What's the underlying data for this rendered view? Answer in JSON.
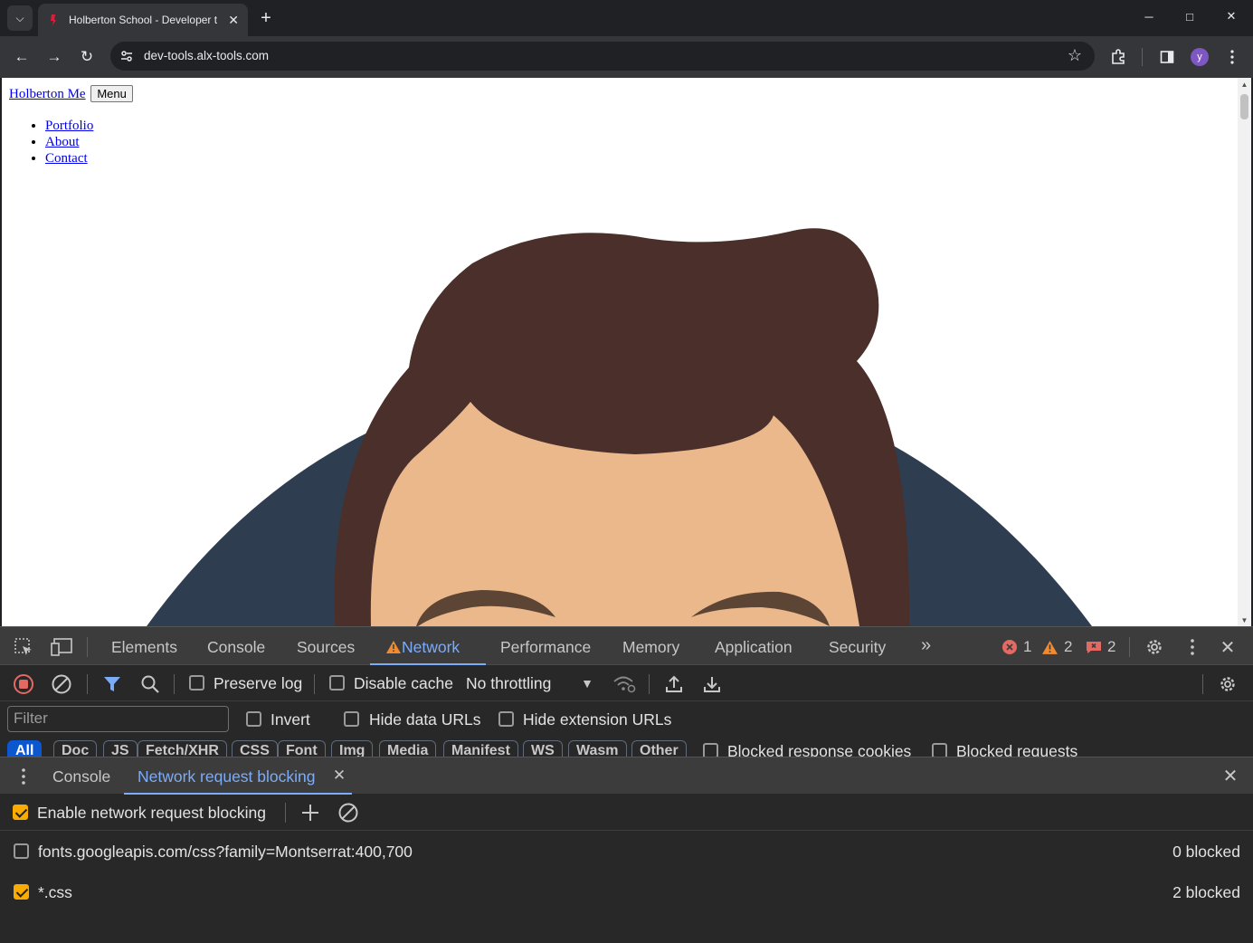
{
  "browser": {
    "tab_title": "Holberton School - Developer t",
    "url": "dev-tools.alx-tools.com",
    "profile_initial": "y"
  },
  "page": {
    "brand_link": "Holberton Me",
    "menu_button": "Menu",
    "nav_links": [
      "Portfolio",
      "About",
      "Contact"
    ]
  },
  "devtools": {
    "tabs": [
      "Elements",
      "Console",
      "Sources",
      "Network",
      "Performance",
      "Memory",
      "Application",
      "Security"
    ],
    "active_tab": "Network",
    "errors": "1",
    "warnings": "2",
    "issues": "2",
    "network_toolbar": {
      "preserve_log": "Preserve log",
      "disable_cache": "Disable cache",
      "throttling": "No throttling"
    },
    "filter": {
      "placeholder": "Filter",
      "invert": "Invert",
      "hide_data_urls": "Hide data URLs",
      "hide_extension_urls": "Hide extension URLs"
    },
    "type_filters": [
      "All",
      "Doc",
      "JS",
      "Fetch/XHR",
      "CSS",
      "Font",
      "Img",
      "Media",
      "Manifest",
      "WS",
      "Wasm",
      "Other"
    ],
    "blocked_response_cookies": "Blocked response cookies",
    "blocked_requests": "Blocked requests",
    "drawer": {
      "tabs": [
        "Console",
        "Network request blocking"
      ],
      "active_tab": "Network request blocking",
      "enable_label": "Enable network request blocking",
      "enable_checked": true,
      "patterns": [
        {
          "url": "fonts.googleapis.com/css?family=Montserrat:400,700",
          "count": "0 blocked",
          "checked": false
        },
        {
          "url": "*.css",
          "count": "2 blocked",
          "checked": true
        }
      ]
    }
  },
  "colors": {
    "accent_blue": "#7cacf8",
    "checkbox_orange": "#f9ab00",
    "hair": "#4a2f2b",
    "skin": "#ebb88b",
    "jacket": "#2e3e50",
    "eyebrow": "#5c4535"
  }
}
